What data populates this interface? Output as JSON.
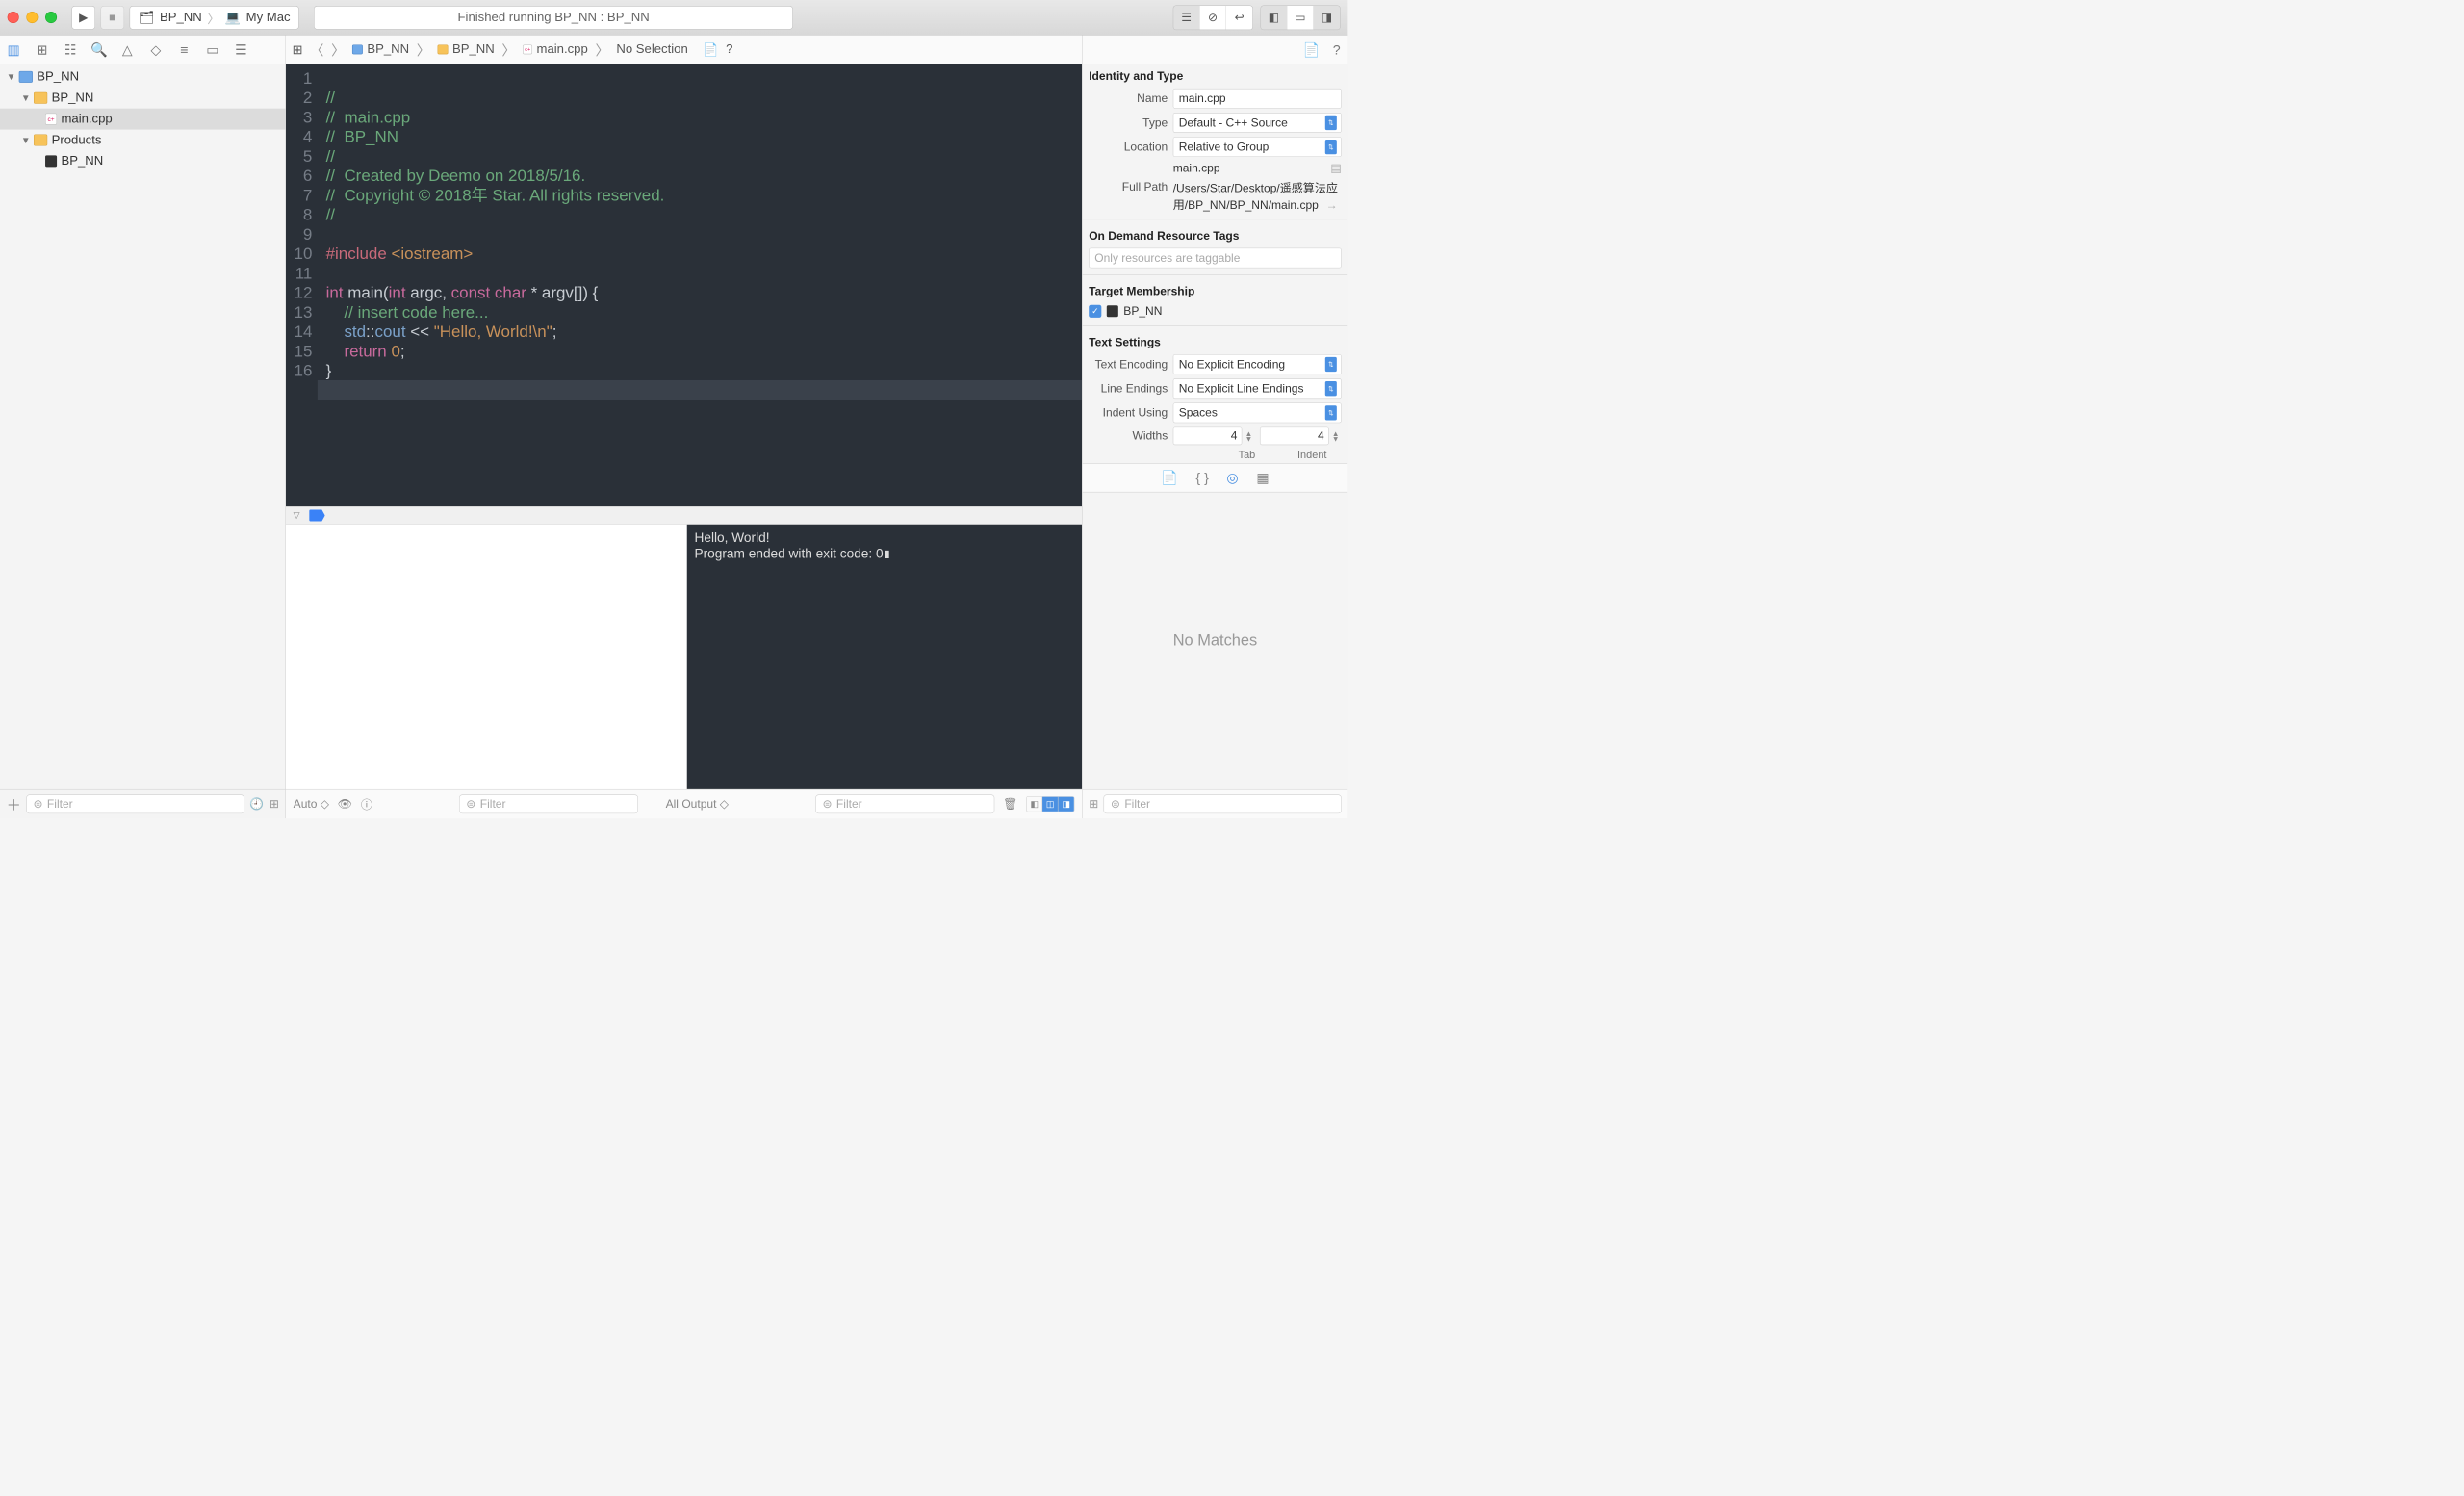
{
  "titlebar": {
    "scheme_target": "BP_NN",
    "scheme_device": "My Mac",
    "status": "Finished running BP_NN : BP_NN"
  },
  "navigator": {
    "root": "BP_NN",
    "group": "BP_NN",
    "file": "main.cpp",
    "products": "Products",
    "product_item": "BP_NN",
    "filter_placeholder": "Filter"
  },
  "jumpbar": {
    "c0": "BP_NN",
    "c1": "BP_NN",
    "c2": "main.cpp",
    "c3": "No Selection"
  },
  "code": {
    "lines": [
      "1",
      "2",
      "3",
      "4",
      "5",
      "6",
      "7",
      "8",
      "9",
      "10",
      "11",
      "12",
      "13",
      "14",
      "15",
      "16"
    ],
    "l1": "//",
    "l2": "//  main.cpp",
    "l3": "//  BP_NN",
    "l4": "//",
    "l5": "//  Created by Deemo on 2018/5/16.",
    "l6": "//  Copyright © 2018年 Star. All rights reserved.",
    "l7": "//",
    "l8": "",
    "l9a": "#include ",
    "l9b": "<iostream>",
    "l10": "",
    "l11_int": "int ",
    "l11_main": "main",
    "l11_p": "(",
    "l11_int2": "int ",
    "l11_argc": "argc, ",
    "l11_const": "const ",
    "l11_char": "char ",
    "l11_star": "* argv[]) {",
    "l12": "    // insert code here...",
    "l13_std": "    std",
    "l13_cc": "::",
    "l13_cout": "cout ",
    "l13_op": "<< ",
    "l13_str": "\"Hello, World!\\n\"",
    "l13_semi": ";",
    "l14_ret": "    return ",
    "l14_zero": "0",
    "l14_semi": ";",
    "l15": "}"
  },
  "console": {
    "out1": "Hello, World!",
    "out2": "Program ended with exit code: 0"
  },
  "bottom": {
    "auto": "Auto ◇",
    "alloutput": "All Output ◇",
    "filter": "Filter"
  },
  "inspector": {
    "identity_title": "Identity and Type",
    "name_label": "Name",
    "name_value": "main.cpp",
    "type_label": "Type",
    "type_value": "Default - C++ Source",
    "location_label": "Location",
    "location_value": "Relative to Group",
    "location_file": "main.cpp",
    "fullpath_label": "Full Path",
    "fullpath_value": "/Users/Star/Desktop/遥感算法应用/BP_NN/BP_NN/main.cpp",
    "odr_title": "On Demand Resource Tags",
    "odr_placeholder": "Only resources are taggable",
    "tm_title": "Target Membership",
    "tm_item": "BP_NN",
    "ts_title": "Text Settings",
    "enc_label": "Text Encoding",
    "enc_value": "No Explicit Encoding",
    "le_label": "Line Endings",
    "le_value": "No Explicit Line Endings",
    "indent_label": "Indent Using",
    "indent_value": "Spaces",
    "widths_label": "Widths",
    "tab_val": "4",
    "indent_val": "4",
    "tab_caption": "Tab",
    "indent_caption": "Indent",
    "nomatch": "No Matches",
    "filter": "Filter"
  }
}
